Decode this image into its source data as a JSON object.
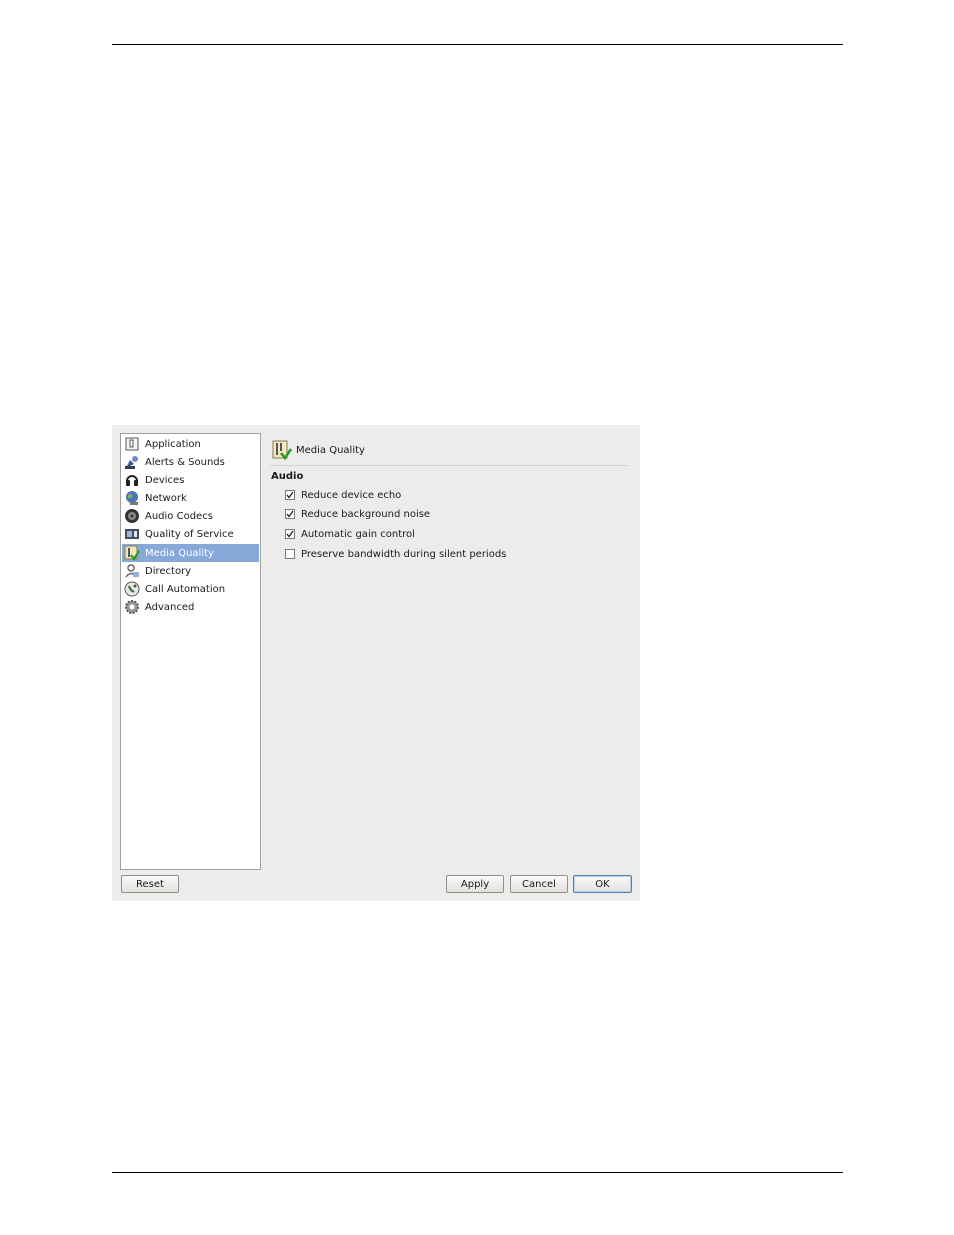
{
  "dialog": {
    "nav": {
      "items": [
        {
          "label": "Application",
          "icon": "application-icon",
          "selected": false
        },
        {
          "label": "Alerts & Sounds",
          "icon": "alerts-sounds-icon",
          "selected": false
        },
        {
          "label": "Devices",
          "icon": "headset-icon",
          "selected": false
        },
        {
          "label": "Network",
          "icon": "network-globe-icon",
          "selected": false
        },
        {
          "label": "Audio Codecs",
          "icon": "audio-codecs-icon",
          "selected": false
        },
        {
          "label": "Quality of Service",
          "icon": "qos-icon",
          "selected": false
        },
        {
          "label": "Media Quality",
          "icon": "media-quality-icon",
          "selected": true
        },
        {
          "label": "Directory",
          "icon": "directory-icon",
          "selected": false
        },
        {
          "label": "Call Automation",
          "icon": "call-automation-icon",
          "selected": false
        },
        {
          "label": "Advanced",
          "icon": "gear-icon",
          "selected": false
        }
      ]
    },
    "panel": {
      "title": "Media Quality",
      "section": "Audio",
      "options": [
        {
          "label": "Reduce device echo",
          "checked": true
        },
        {
          "label": "Reduce background noise",
          "checked": true
        },
        {
          "label": "Automatic gain control",
          "checked": true
        },
        {
          "label": "Preserve bandwidth during silent periods",
          "checked": false
        }
      ]
    },
    "buttons": {
      "reset": "Reset",
      "apply": "Apply",
      "cancel": "Cancel",
      "ok": "OK"
    },
    "colors": {
      "selection": "#86a9d9",
      "dialog_bg": "#edecea"
    }
  }
}
